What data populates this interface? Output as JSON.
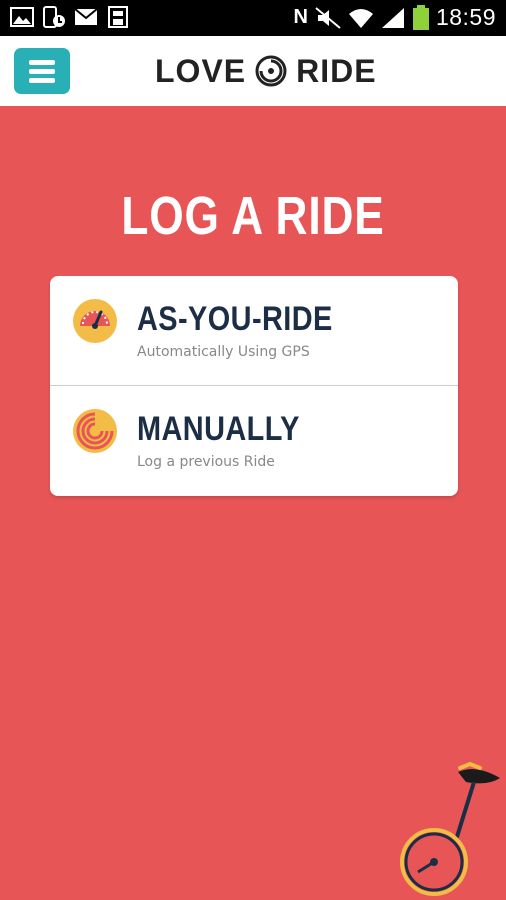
{
  "status_bar": {
    "time": "18:59",
    "network_letter": "N",
    "left_icons": [
      "image-icon",
      "phone-update-icon",
      "mail-icon",
      "save-icon"
    ],
    "right_icons": [
      "mute-icon",
      "wifi-icon",
      "signal-icon",
      "battery-icon"
    ]
  },
  "header": {
    "menu_icon": "hamburger-menu-icon",
    "logo_text_left": "LOVE",
    "logo_text_right": "RIDE",
    "logo_alt": "LOVE TO RIDE"
  },
  "main": {
    "title": "LOG A RIDE",
    "options": [
      {
        "title": "AS-YOU-RIDE",
        "subtitle": "Automatically Using GPS",
        "icon": "speedometer-icon"
      },
      {
        "title": "MANUALLY",
        "subtitle": "Log a previous Ride",
        "icon": "spiral-icon"
      }
    ]
  },
  "decoration": {
    "illustration": "unicycle-illustration"
  },
  "colors": {
    "background": "#e85557",
    "accent": "#29b0b6",
    "icon_yellow": "#f3bc46",
    "icon_red": "#e85557",
    "title_navy": "#1c2e46"
  }
}
